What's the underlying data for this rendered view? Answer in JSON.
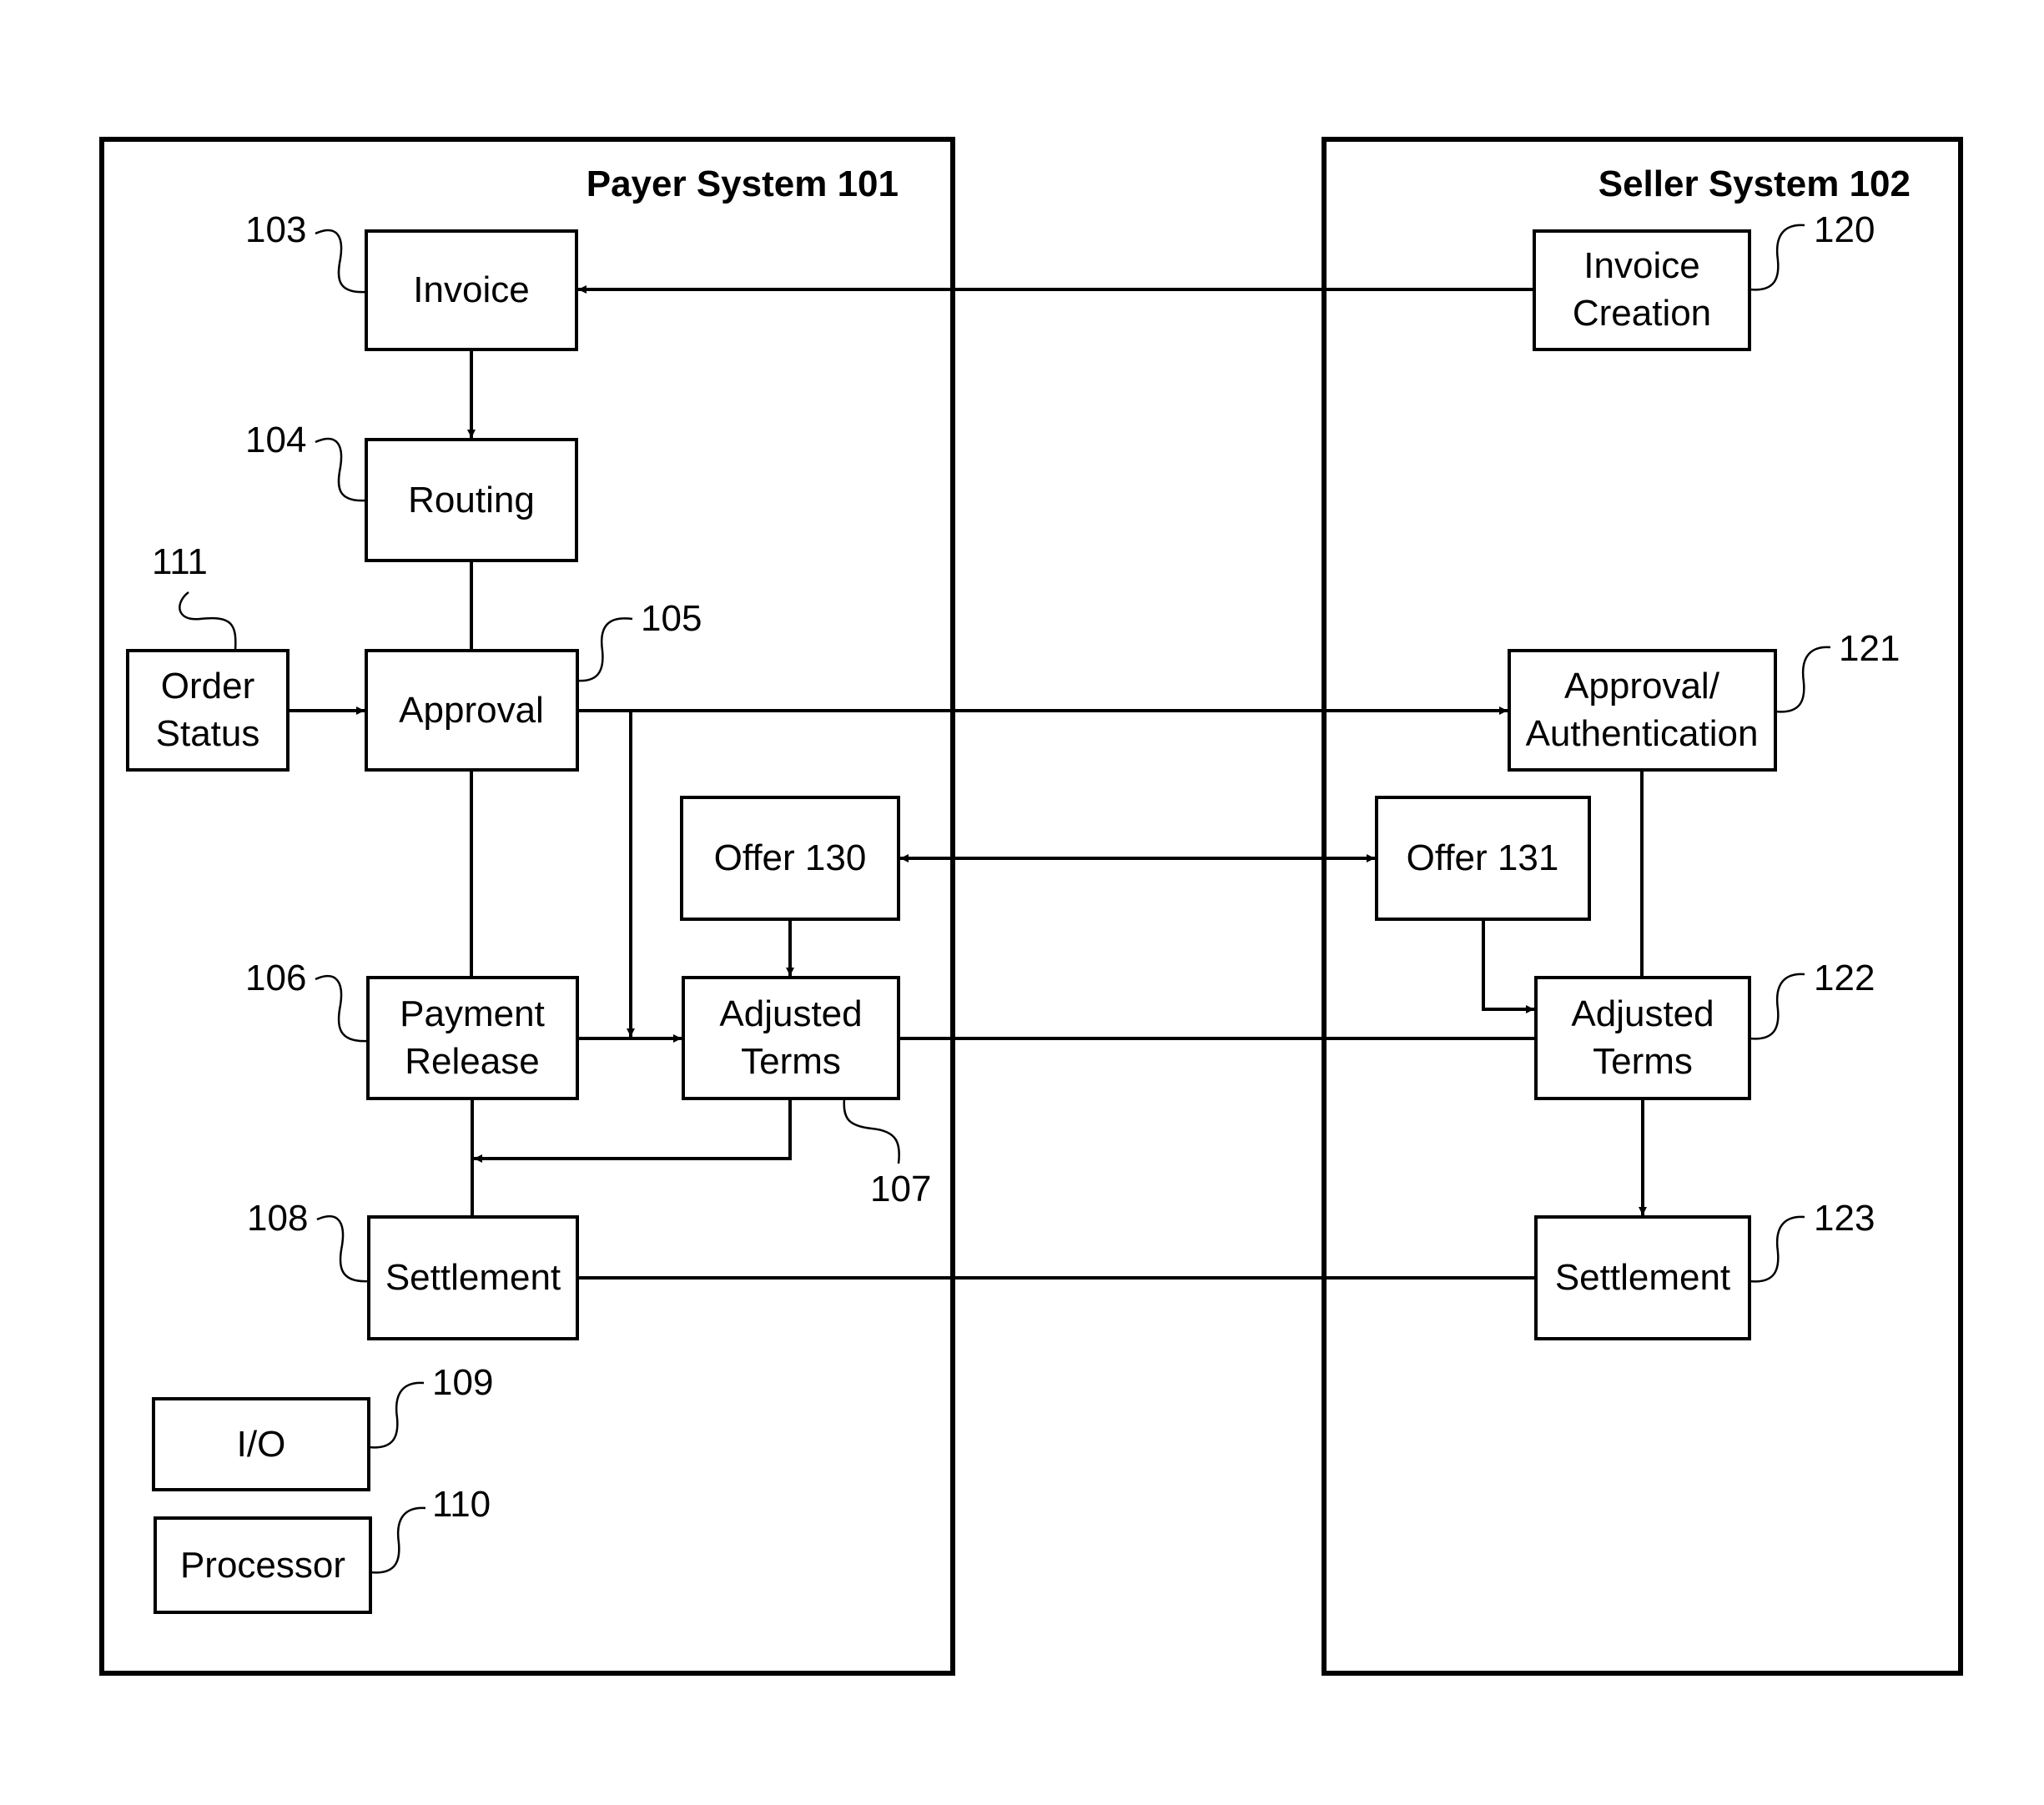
{
  "figure": {
    "type": "block diagram",
    "systems": [
      {
        "id": "payer",
        "title": "Payer System 101"
      },
      {
        "id": "seller",
        "title": "Seller System 102"
      }
    ],
    "payer_blocks": {
      "invoice": {
        "label_lines": [
          "Invoice"
        ],
        "ref": "103"
      },
      "routing": {
        "label_lines": [
          "Routing"
        ],
        "ref": "104"
      },
      "order_status": {
        "label_lines": [
          "Order",
          "Status"
        ],
        "ref": "111"
      },
      "approval": {
        "label_lines": [
          "Approval"
        ],
        "ref": "105"
      },
      "offer": {
        "label_lines": [
          "Offer 130"
        ]
      },
      "payment_release": {
        "label_lines": [
          "Payment",
          "Release"
        ],
        "ref": "106"
      },
      "adjusted_terms": {
        "label_lines": [
          "Adjusted",
          "Terms"
        ],
        "ref": "107"
      },
      "settlement": {
        "label_lines": [
          "Settlement"
        ],
        "ref": "108"
      },
      "io": {
        "label_lines": [
          "I/O"
        ],
        "ref": "109"
      },
      "processor": {
        "label_lines": [
          "Processor"
        ],
        "ref": "110"
      }
    },
    "seller_blocks": {
      "invoice_creation": {
        "label_lines": [
          "Invoice",
          "Creation"
        ],
        "ref": "120"
      },
      "approval_auth": {
        "label_lines": [
          "Approval/",
          "Authentication"
        ],
        "ref": "121"
      },
      "offer": {
        "label_lines": [
          "Offer 131"
        ]
      },
      "adjusted_terms": {
        "label_lines": [
          "Adjusted",
          "Terms"
        ],
        "ref": "122"
      },
      "settlement": {
        "label_lines": [
          "Settlement"
        ],
        "ref": "123"
      }
    },
    "connections": [
      {
        "from": "Invoice Creation 120",
        "to": "Invoice 103",
        "arrow": "to"
      },
      {
        "from": "Invoice 103",
        "to": "Routing 104",
        "arrow": "to"
      },
      {
        "from": "Routing 104",
        "to": "Approval 105",
        "arrow": "none"
      },
      {
        "from": "Order Status 111",
        "to": "Approval 105",
        "arrow": "to"
      },
      {
        "from": "Approval 105",
        "to": "Approval/Authentication 121",
        "arrow": "to"
      },
      {
        "from": "Approval 105",
        "to": "Adjusted Terms 107",
        "arrow": "to"
      },
      {
        "from": "Approval 105",
        "to": "Payment Release 106",
        "arrow": "none"
      },
      {
        "from": "Offer 130",
        "to": "Offer 131",
        "arrow": "both"
      },
      {
        "from": "Offer 130",
        "to": "Adjusted Terms 107",
        "arrow": "to"
      },
      {
        "from": "Payment Release 106",
        "to": "Adjusted Terms 107",
        "arrow": "to"
      },
      {
        "from": "Adjusted Terms 107",
        "to": "Adjusted Terms 122",
        "arrow": "none"
      },
      {
        "from": "Adjusted Terms 107",
        "to": "Payment Release 106 / Settlement 108 line",
        "arrow": "to"
      },
      {
        "from": "Payment Release 106",
        "to": "Settlement 108",
        "arrow": "none"
      },
      {
        "from": "Approval/Authentication 121",
        "to": "Adjusted Terms 122",
        "arrow": "none"
      },
      {
        "from": "Offer 131",
        "to": "Adjusted Terms 122",
        "arrow": "to"
      },
      {
        "from": "Adjusted Terms 122",
        "to": "Settlement 123",
        "arrow": "to"
      },
      {
        "from": "Settlement 108",
        "to": "Settlement 123",
        "arrow": "none"
      }
    ]
  }
}
